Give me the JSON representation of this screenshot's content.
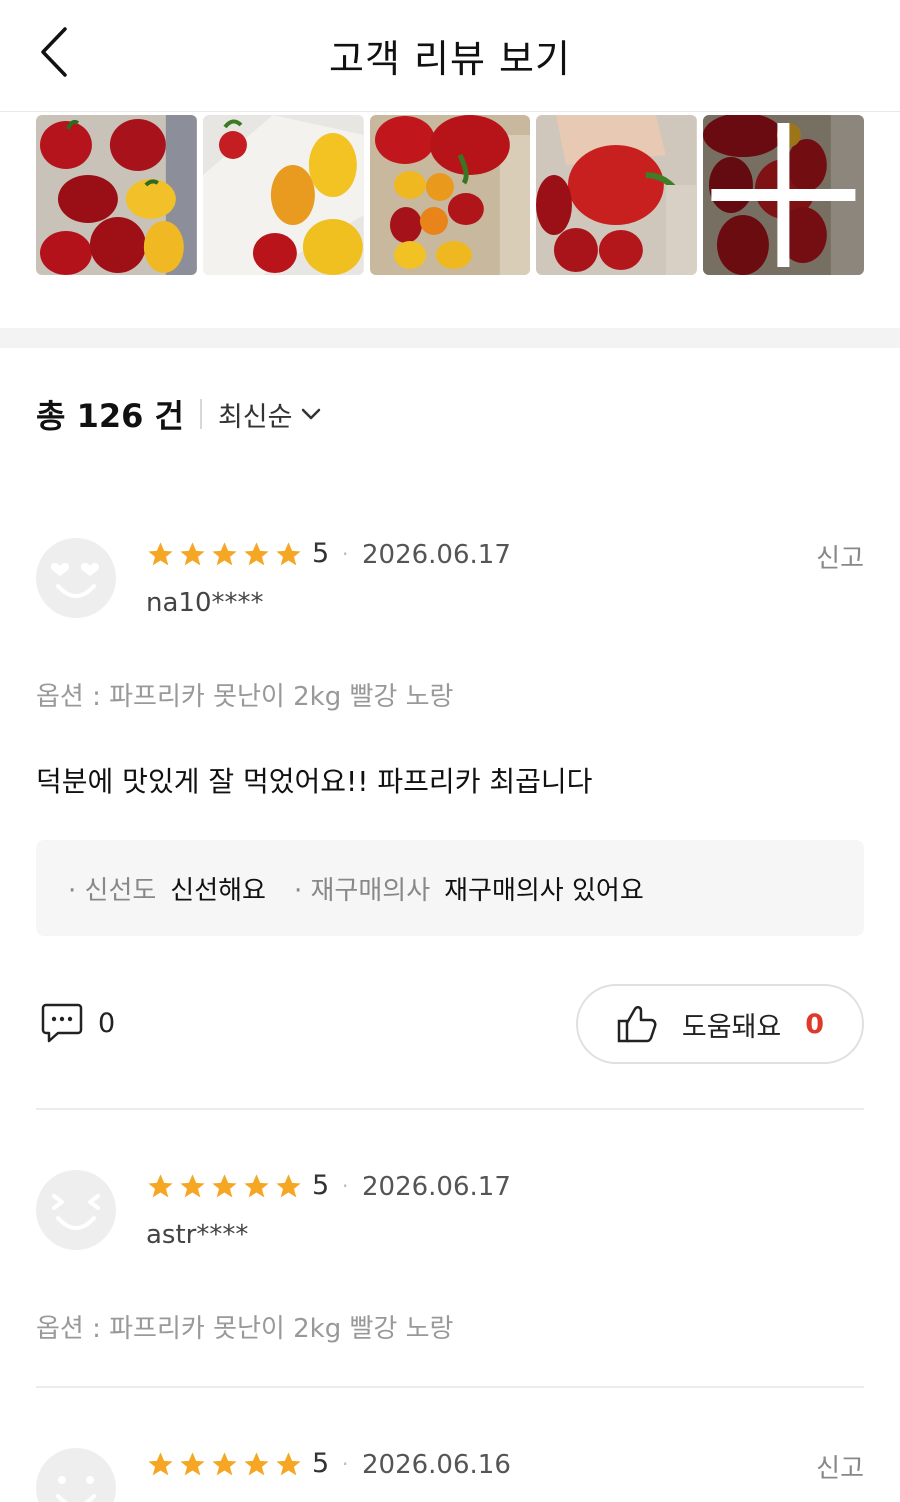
{
  "header": {
    "title": "고객 리뷰 보기"
  },
  "photos": [
    {
      "name": "red and yellow peppers"
    },
    {
      "name": "peppers in paper"
    },
    {
      "name": "peppers in box"
    },
    {
      "name": "hand holding red pepper"
    },
    {
      "name": "more photos",
      "more": true
    }
  ],
  "summary": {
    "total": "총 126 건",
    "sort_label": "최신순"
  },
  "reviews": [
    {
      "rating": "5",
      "date": "2026.06.17",
      "report": "신고",
      "user": "na10****",
      "option": "옵션 : 파프리카 못난이 2kg 빨강 노랑",
      "content": "덕분에 맛있게 잘 먹었어요!! 파프리카 최곱니다",
      "attrs": [
        {
          "key": "· 신선도",
          "value": "신선해요"
        },
        {
          "key": "· 재구매의사",
          "value": "재구매의사 있어요"
        }
      ],
      "comments": "0",
      "helpful_label": "도움돼요",
      "helpful_count": "0"
    },
    {
      "rating": "5",
      "date": "2026.06.17",
      "user": "astr****",
      "option": "옵션 : 파프리카 못난이 2kg 빨강 노랑"
    },
    {
      "rating": "5",
      "date": "2026.06.16",
      "report": "신고"
    }
  ],
  "colors": {
    "star": "#f5a623",
    "helpful_count": "#e0392b",
    "text": "#111111",
    "muted": "#999999"
  }
}
